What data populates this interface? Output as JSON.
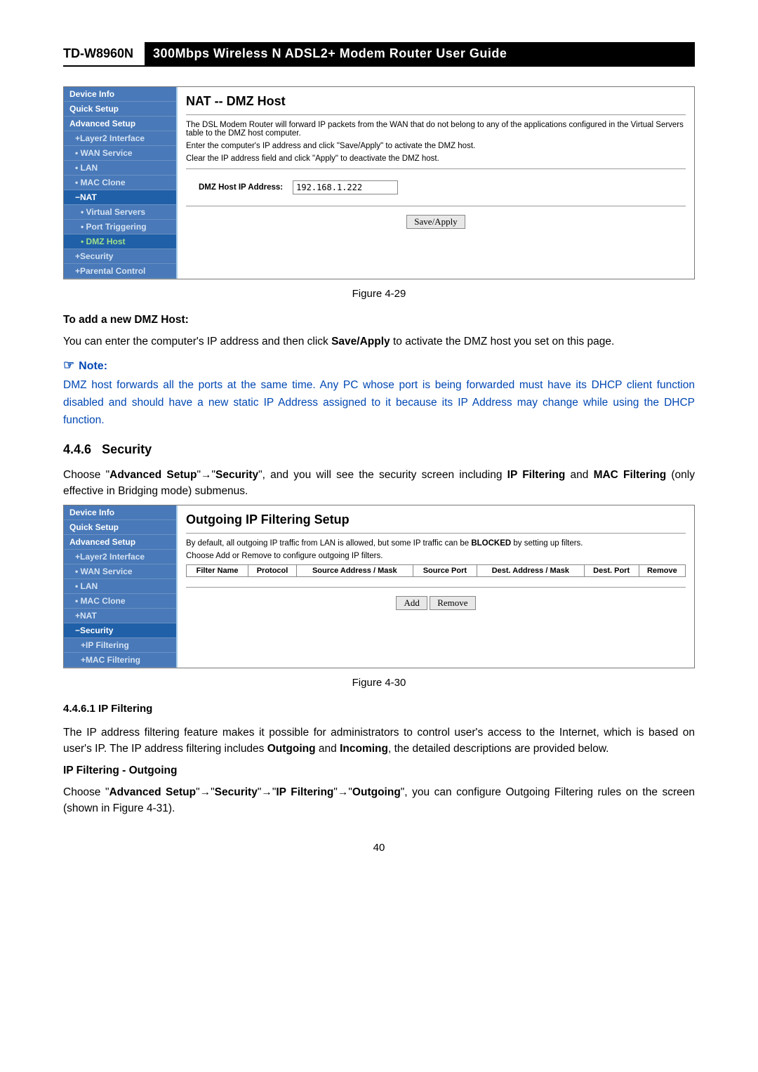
{
  "header": {
    "model": "TD-W8960N",
    "title": "300Mbps Wireless N ADSL2+ Modem Router User Guide"
  },
  "fig1": {
    "nav": {
      "items": [
        {
          "label": "Device Info",
          "cls": ""
        },
        {
          "label": "Quick Setup",
          "cls": ""
        },
        {
          "label": "Advanced Setup",
          "cls": ""
        },
        {
          "label": "+Layer2 Interface",
          "cls": "sub1 dim"
        },
        {
          "label": "• WAN Service",
          "cls": "sub1 dim"
        },
        {
          "label": "• LAN",
          "cls": "sub1 dim"
        },
        {
          "label": "• MAC Clone",
          "cls": "sub1 dim"
        },
        {
          "label": "−NAT",
          "cls": "sub1 active-parent"
        },
        {
          "label": "• Virtual Servers",
          "cls": "sub2 dim"
        },
        {
          "label": "• Port Triggering",
          "cls": "sub2 dim"
        },
        {
          "label": "• DMZ Host",
          "cls": "sub2 active"
        },
        {
          "label": "+Security",
          "cls": "sub1 dim"
        },
        {
          "label": "+Parental Control",
          "cls": "sub1 dim"
        }
      ]
    },
    "title": "NAT -- DMZ Host",
    "p1": "The DSL Modem Router will forward IP packets from the WAN that do not belong to any of the applications configured in the Virtual Servers table to the DMZ host computer.",
    "p2": "Enter the computer's IP address and click \"Save/Apply\" to activate the DMZ host.",
    "p3": "Clear the IP address field and click \"Apply\" to deactivate the DMZ host.",
    "field_label": "DMZ Host IP Address:",
    "field_value": "192.168.1.222",
    "button": "Save/Apply",
    "caption": "Figure 4-29"
  },
  "sec_addhost": {
    "heading": "To add a new DMZ Host:",
    "text_pre": "You can enter the computer's IP address and then click ",
    "text_bold": "Save/Apply",
    "text_post": " to activate the DMZ host you set on this page."
  },
  "note": {
    "label": "Note:",
    "text": "DMZ host forwards all the ports at the same time. Any PC whose port is being forwarded must have its DHCP client function disabled and should have a new static IP Address assigned to it because its IP Address may change while using the DHCP function."
  },
  "sec446": {
    "num": "4.4.6",
    "title": "Security",
    "para_parts": {
      "a": "Choose \"",
      "b": "Advanced Setup",
      "c": "\"",
      "arrow": "→",
      "d": "\"",
      "e": "Security",
      "f": "\", and you will see the security screen including ",
      "g": "IP Filtering",
      "h": " and ",
      "i": "MAC Filtering",
      "j": " (only effective in Bridging mode) submenus."
    }
  },
  "fig2": {
    "nav": {
      "items": [
        {
          "label": "Device Info",
          "cls": ""
        },
        {
          "label": "Quick Setup",
          "cls": ""
        },
        {
          "label": "Advanced Setup",
          "cls": ""
        },
        {
          "label": "+Layer2 Interface",
          "cls": "sub1 dim"
        },
        {
          "label": "• WAN Service",
          "cls": "sub1 dim"
        },
        {
          "label": "• LAN",
          "cls": "sub1 dim"
        },
        {
          "label": "• MAC Clone",
          "cls": "sub1 dim"
        },
        {
          "label": "+NAT",
          "cls": "sub1 dim"
        },
        {
          "label": "−Security",
          "cls": "sub1 active-parent"
        },
        {
          "label": "+IP Filtering",
          "cls": "sub2 dim"
        },
        {
          "label": "+MAC Filtering",
          "cls": "sub2 dim"
        }
      ]
    },
    "title": "Outgoing IP Filtering Setup",
    "p1a": "By default, all outgoing IP traffic from LAN is allowed, but some IP traffic can be ",
    "p1b": "BLOCKED",
    "p1c": " by setting up filters.",
    "p2": "Choose Add or Remove to configure outgoing IP filters.",
    "columns": [
      "Filter Name",
      "Protocol",
      "Source Address / Mask",
      "Source Port",
      "Dest. Address / Mask",
      "Dest. Port",
      "Remove"
    ],
    "btn1": "Add",
    "btn2": "Remove",
    "caption": "Figure 4-30"
  },
  "sec4461": {
    "heading": "4.4.6.1   IP Filtering",
    "p1a": "The IP address filtering feature makes it possible for administrators to control user's access to the Internet, which is based on user's IP. The IP address filtering includes ",
    "p1b": "Outgoing",
    "p1c": " and ",
    "p1d": "Incoming",
    "p1e": ", the detailed descriptions are provided below."
  },
  "sec_outgoing": {
    "heading": "IP Filtering - Outgoing",
    "parts": {
      "a": "Choose \"",
      "b1": "Advanced Setup",
      "arrow": "→",
      "b2": "Security",
      "b3": "IP Filtering",
      "b4": "Outgoing",
      "c": "\", you can configure Outgoing Filtering rules on the screen (shown in Figure 4-31)."
    }
  },
  "page_number": "40"
}
